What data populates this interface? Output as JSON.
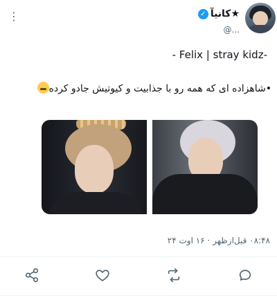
{
  "user": {
    "display_name": "★کانیآ",
    "handle": "@..."
  },
  "tweet": {
    "line1": "- Felix | stray kidz-",
    "line2": "•شاهزاده ای که همه رو با جذابیت و کیوتیش جادو کرده",
    "timestamp": "۰۸:۴۸ قبل‌ازظهر · ۱۶ اوت ۲۴"
  },
  "icons": {
    "verified": "verified-badge-icon",
    "more": "more-dots-icon",
    "emoji": "laughing-emoji",
    "share": "share-icon",
    "like": "heart-icon",
    "retweet": "retweet-icon",
    "reply": "reply-icon"
  },
  "colors": {
    "accent": "#1d9bf0",
    "secondary_text": "#536471",
    "separator": "#eff3f4"
  }
}
